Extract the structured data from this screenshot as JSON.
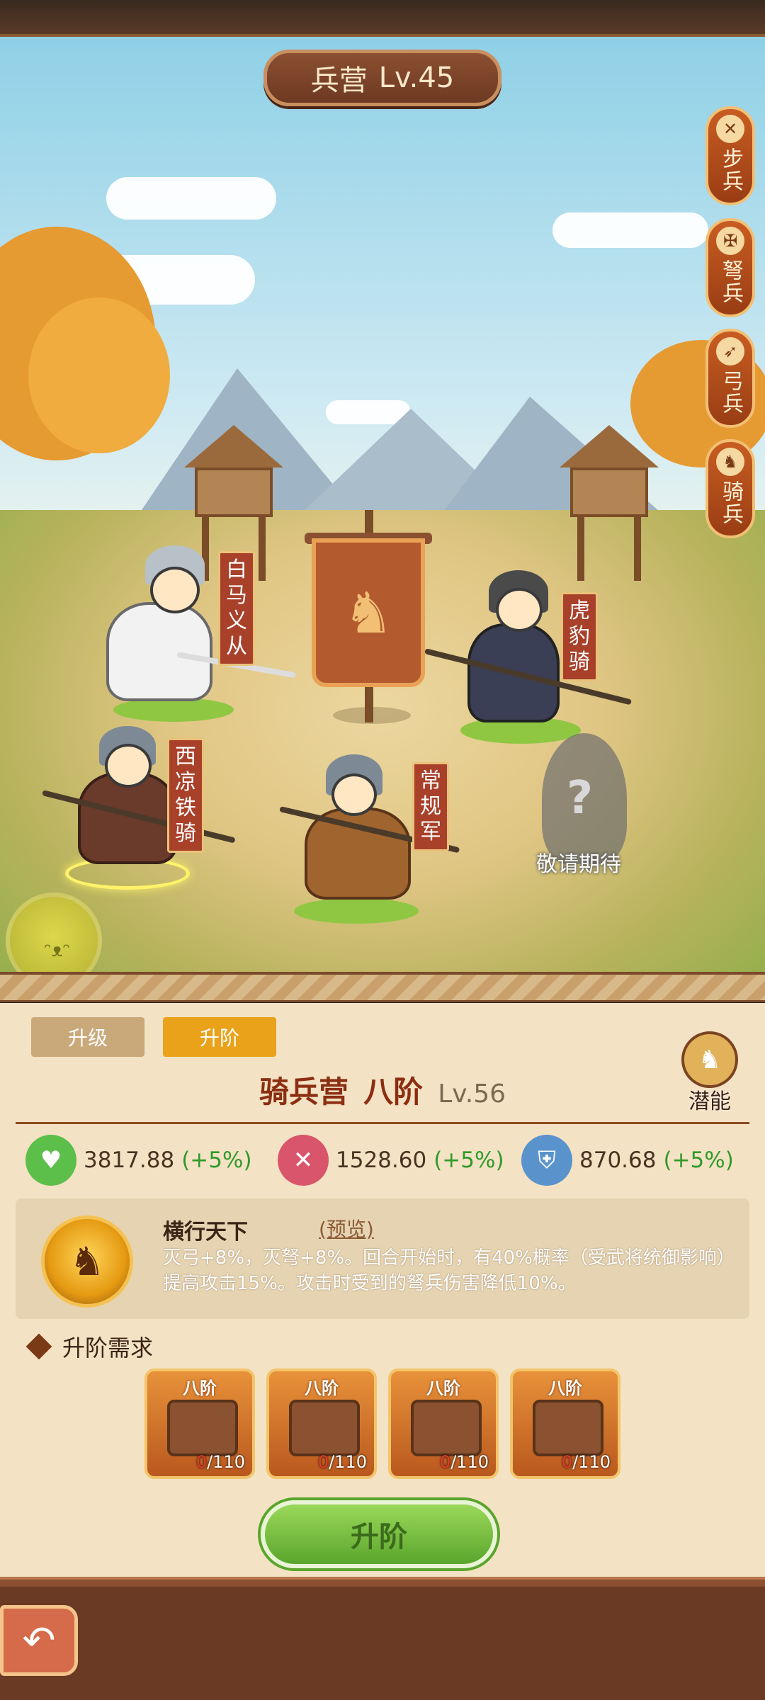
{
  "title": {
    "building": "兵营",
    "level": "Lv.45"
  },
  "side_tabs": [
    {
      "label": "步兵",
      "icon": "crossed-swords-icon"
    },
    {
      "label": "弩兵",
      "icon": "crossbow-icon"
    },
    {
      "label": "弓兵",
      "icon": "bow-icon"
    },
    {
      "label": "骑兵",
      "icon": "horse-icon"
    }
  ],
  "units": {
    "baima": "白马义从",
    "hubao": "虎豹骑",
    "xiliang": "西凉铁骑",
    "changgui": "常规军",
    "locked": "敬请期待"
  },
  "tabs": {
    "upgrade": "升级",
    "advance": "升阶"
  },
  "potential_label": "潜能",
  "camp": {
    "name": "骑兵营",
    "grade": "八阶",
    "level": "Lv.56"
  },
  "stats": {
    "hp": {
      "value": "3817.88",
      "bonus": "(+5%)",
      "icon": "heart-icon",
      "color": "#5cbf4a"
    },
    "atk": {
      "value": "1528.60",
      "bonus": "(+5%)",
      "icon": "crossed-swords-icon",
      "color": "#d9556b"
    },
    "def": {
      "value": "870.68",
      "bonus": "(+5%)",
      "icon": "shield-icon",
      "color": "#5a93cc"
    }
  },
  "skill": {
    "name": "横行天下",
    "preview": "(预览)",
    "description": "灭弓+8%，灭弩+8%。回合开始时，有40%概率（受武将统御影响）提高攻击15%。攻击时受到的弩兵伤害降低10%。"
  },
  "requirements": {
    "title": "升阶需求",
    "items": [
      {
        "grade": "八阶",
        "have": "0",
        "need": "/110",
        "icon": "siege-cart-icon"
      },
      {
        "grade": "八阶",
        "have": "0",
        "need": "/110",
        "icon": "siege-tower-icon"
      },
      {
        "grade": "八阶",
        "have": "0",
        "need": "/110",
        "icon": "barricade-icon"
      },
      {
        "grade": "八阶",
        "have": "0",
        "need": "/110",
        "icon": "catapult-icon"
      }
    ]
  },
  "advance_button": "升阶"
}
